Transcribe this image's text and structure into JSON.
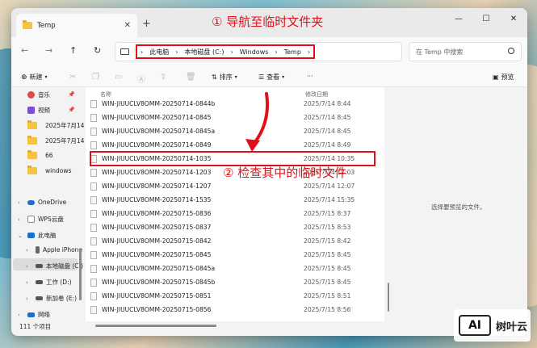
{
  "window": {
    "tab_title": "Temp",
    "new_tab": "+",
    "controls": [
      "—",
      "☐",
      "✕"
    ]
  },
  "nav": {
    "back": "←",
    "forward": "→",
    "up": "↑",
    "refresh": "↻"
  },
  "breadcrumb": [
    "此电脑",
    "本地磁盘 (C:)",
    "Windows",
    "Temp"
  ],
  "search": {
    "placeholder": "在 Temp 中搜索"
  },
  "toolbar": {
    "new_label": "新建",
    "sort_label": "排序",
    "view_label": "查看",
    "more": "···",
    "preview_label": "预览"
  },
  "sidebar": {
    "items": [
      {
        "label": "音乐",
        "icon": "music-icon",
        "color": "#e04a4a"
      },
      {
        "label": "视频",
        "icon": "video-icon",
        "color": "#7a4fd6"
      },
      {
        "label": "2025年7月14",
        "icon": "folder-icon",
        "color": "#f5c242"
      },
      {
        "label": "2025年7月14",
        "icon": "folder-icon",
        "color": "#f5c242"
      },
      {
        "label": "66",
        "icon": "folder-icon",
        "color": "#f5c242"
      },
      {
        "label": "windows",
        "icon": "folder-icon",
        "color": "#f5c242"
      },
      {
        "label": "OneDrive",
        "icon": "cloud-icon",
        "color": "#1a6fd1"
      },
      {
        "label": "WPS云盘",
        "icon": "wps-cloud-icon",
        "color": "#888888"
      },
      {
        "label": "此电脑",
        "icon": "pc-icon",
        "color": "#1a6fd1"
      },
      {
        "label": "Apple iPhone",
        "icon": "phone-icon",
        "color": "#666666"
      },
      {
        "label": "本地磁盘 (C:)",
        "icon": "drive-icon",
        "color": "#555555"
      },
      {
        "label": "工作 (D:)",
        "icon": "drive-icon",
        "color": "#555555"
      },
      {
        "label": "新加卷 (E:)",
        "icon": "drive-icon",
        "color": "#555555"
      },
      {
        "label": "网络",
        "icon": "network-icon",
        "color": "#1a6fd1"
      }
    ]
  },
  "columns": {
    "name": "名称",
    "date": "修改日期"
  },
  "files": [
    {
      "name": "WIN-JIUUCLV8OMM-20250714-0844b",
      "date": "2025/7/14 8:44"
    },
    {
      "name": "WIN-JIUUCLV8OMM-20250714-0845",
      "date": "2025/7/14 8:45"
    },
    {
      "name": "WIN-JIUUCLV8OMM-20250714-0845a",
      "date": "2025/7/14 8:45"
    },
    {
      "name": "WIN-JIUUCLV8OMM-20250714-0849",
      "date": "2025/7/14 8:49"
    },
    {
      "name": "WIN-JIUUCLV8OMM-20250714-1035",
      "date": "2025/7/14 10:35"
    },
    {
      "name": "WIN-JIUUCLV8OMM-20250714-1203",
      "date": "2025/7/14 12:03"
    },
    {
      "name": "WIN-JIUUCLV8OMM-20250714-1207",
      "date": "2025/7/14 12:07"
    },
    {
      "name": "WIN-JIUUCLV8OMM-20250714-1535",
      "date": "2025/7/14 15:35"
    },
    {
      "name": "WIN-JIUUCLV8OMM-20250715-0836",
      "date": "2025/7/15 8:37"
    },
    {
      "name": "WIN-JIUUCLV8OMM-20250715-0837",
      "date": "2025/7/15 8:53"
    },
    {
      "name": "WIN-JIUUCLV8OMM-20250715-0842",
      "date": "2025/7/15 8:42"
    },
    {
      "name": "WIN-JIUUCLV8OMM-20250715-0845",
      "date": "2025/7/15 8:45"
    },
    {
      "name": "WIN-JIUUCLV8OMM-20250715-0845a",
      "date": "2025/7/15 8:45"
    },
    {
      "name": "WIN-JIUUCLV8OMM-20250715-0845b",
      "date": "2025/7/15 8:45"
    },
    {
      "name": "WIN-JIUUCLV8OMM-20250715-0851",
      "date": "2025/7/15 8:51"
    },
    {
      "name": "WIN-JIUUCLV8OMM-20250715-0856",
      "date": "2025/7/15 8:56"
    }
  ],
  "preview_pane": {
    "empty_text": "选择要预览的文件。"
  },
  "status": {
    "count": "111 个项目"
  },
  "annotations": {
    "step1": "① 导航至临时文件夹",
    "step2": "② 检查其中的临时文件",
    "accent_color": "#e0101a"
  },
  "watermark": {
    "logo": "AI",
    "text": "树叶云"
  }
}
